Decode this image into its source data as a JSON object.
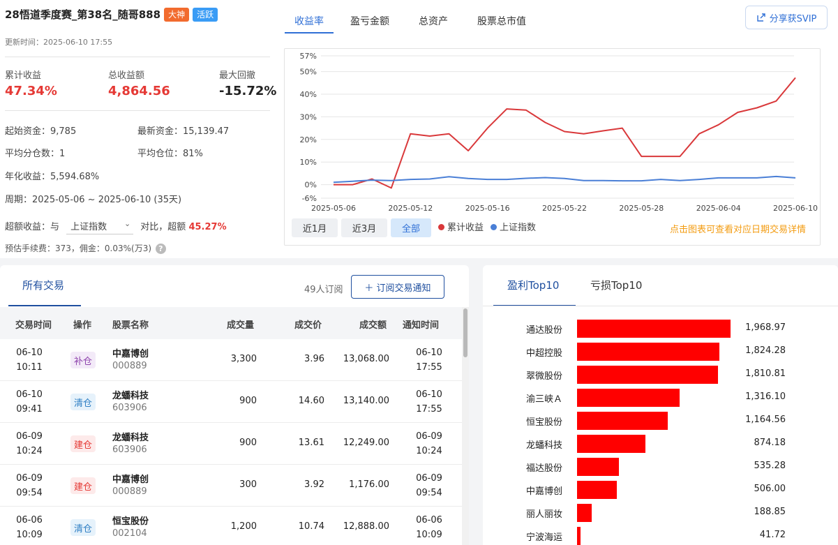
{
  "header": {
    "title": "28悟道季度赛_第38名_随哥888",
    "badges": [
      "大神",
      "活跃"
    ],
    "updated": "更新时间：2025-06-10 17:55",
    "share_label": "分享获SVIP"
  },
  "kpis": [
    {
      "label": "累计收益",
      "value": "47.34%",
      "color": "#e53935"
    },
    {
      "label": "总收益额",
      "value": "4,864.56",
      "color": "#e53935"
    },
    {
      "label": "最大回撤",
      "value": "-15.72%",
      "color": "#222222"
    }
  ],
  "stats": {
    "start_capital": "起始资金：9,785",
    "latest_capital": "最新资金：15,139.47",
    "avg_split": "平均分仓数：1",
    "avg_position": "平均仓位：81%",
    "annual": "年化收益：5,594.68%",
    "period": "周期：2025-05-06 ~ 2025-06-10 (35天)",
    "excess_prefix": "超额收益：与",
    "benchmark": "上证指数",
    "excess_mid": "对比，超额",
    "excess_value": "45.27%",
    "fees": "预估手续费：373，佣金：0.03%(万3)"
  },
  "chart_tabs": [
    "收益率",
    "盈亏金额",
    "总资产",
    "股票总市值"
  ],
  "range_buttons": [
    "近1月",
    "近3月",
    "全部"
  ],
  "legend": [
    "累计收益",
    "上证指数"
  ],
  "hint": "点击图表可查看对应日期交易详情",
  "chart_data": {
    "type": "line",
    "x": [
      "2025-05-06",
      "2025-05-07",
      "2025-05-08",
      "2025-05-09",
      "2025-05-12",
      "2025-05-13",
      "2025-05-14",
      "2025-05-15",
      "2025-05-16",
      "2025-05-19",
      "2025-05-20",
      "2025-05-21",
      "2025-05-22",
      "2025-05-23",
      "2025-05-26",
      "2025-05-27",
      "2025-05-28",
      "2025-05-29",
      "2025-05-30",
      "2025-06-03",
      "2025-06-04",
      "2025-06-05",
      "2025-06-06",
      "2025-06-09",
      "2025-06-10"
    ],
    "x_tick_labels": [
      "2025-05-06",
      "2025-05-12",
      "2025-05-16",
      "2025-05-22",
      "2025-05-28",
      "2025-06-04",
      "2025-06-10"
    ],
    "series": [
      {
        "name": "累计收益",
        "color": "#d9383a",
        "values": [
          0,
          0,
          2.5,
          -1.5,
          22.5,
          21.5,
          22.5,
          15,
          25,
          33.5,
          33,
          27.5,
          23.5,
          22.5,
          23.8,
          25,
          12.5,
          12.5,
          12.5,
          22.5,
          26.5,
          32,
          34,
          37,
          47.3
        ]
      },
      {
        "name": "上证指数",
        "color": "#4a7fd6",
        "values": [
          1,
          1.5,
          2,
          1.8,
          2.3,
          2.5,
          3.5,
          2.7,
          2.3,
          2.3,
          2.8,
          3.1,
          2.7,
          1.8,
          1.8,
          1.7,
          1.7,
          2.3,
          1.8,
          2.3,
          3,
          3,
          3,
          3.6,
          3
        ]
      }
    ],
    "y_ticks": [
      "57%",
      "50%",
      "40%",
      "30%",
      "20%",
      "10%",
      "0%",
      "-6%"
    ],
    "ylim": [
      -6,
      57
    ],
    "grid": "horizontal",
    "legend": "bottom-left"
  },
  "trades": {
    "tab_label": "所有交易",
    "subscribe_count": "49人订阅",
    "subscribe_label": "＋ 订阅交易通知",
    "columns": [
      "交易时间",
      "操作",
      "股票名称",
      "成交量",
      "成交价",
      "成交额",
      "通知时间"
    ],
    "rows": [
      {
        "date": "06-10",
        "time": "10:11",
        "op": "补仓",
        "op_style": "purple",
        "name": "中嘉博创",
        "code": "000889",
        "qty": "3,300",
        "price": "3.96",
        "amount": "13,068.00",
        "ndate": "06-10",
        "ntime": "17:55"
      },
      {
        "date": "06-10",
        "time": "09:41",
        "op": "清仓",
        "op_style": "blue",
        "name": "龙蟠科技",
        "code": "603906",
        "qty": "900",
        "price": "14.60",
        "amount": "13,140.00",
        "ndate": "06-10",
        "ntime": "17:55"
      },
      {
        "date": "06-09",
        "time": "10:24",
        "op": "建仓",
        "op_style": "red",
        "name": "龙蟠科技",
        "code": "603906",
        "qty": "900",
        "price": "13.61",
        "amount": "12,249.00",
        "ndate": "06-09",
        "ntime": "10:24"
      },
      {
        "date": "06-09",
        "time": "09:54",
        "op": "建仓",
        "op_style": "red",
        "name": "中嘉博创",
        "code": "000889",
        "qty": "300",
        "price": "3.92",
        "amount": "1,176.00",
        "ndate": "06-09",
        "ntime": "09:54"
      },
      {
        "date": "06-06",
        "time": "10:09",
        "op": "清仓",
        "op_style": "blue",
        "name": "恒宝股份",
        "code": "002104",
        "qty": "1,200",
        "price": "10.74",
        "amount": "12,888.00",
        "ndate": "06-06",
        "ntime": "10:09"
      }
    ]
  },
  "top10": {
    "tabs": [
      "盈利Top10",
      "亏损Top10"
    ],
    "bar_color": "#ff0000",
    "max_value": 1968.97,
    "items": [
      {
        "name": "通达股份",
        "value": 1968.97,
        "label": "1,968.97"
      },
      {
        "name": "中超控股",
        "value": 1824.28,
        "label": "1,824.28"
      },
      {
        "name": "翠微股份",
        "value": 1810.81,
        "label": "1,810.81"
      },
      {
        "name": "渝三峡Ａ",
        "value": 1316.1,
        "label": "1,316.10"
      },
      {
        "name": "恒宝股份",
        "value": 1164.56,
        "label": "1,164.56"
      },
      {
        "name": "龙蟠科技",
        "value": 874.18,
        "label": "874.18"
      },
      {
        "name": "福达股份",
        "value": 535.28,
        "label": "535.28"
      },
      {
        "name": "中嘉博创",
        "value": 506.0,
        "label": "506.00"
      },
      {
        "name": "丽人丽妆",
        "value": 188.85,
        "label": "188.85"
      },
      {
        "name": "宁波海运",
        "value": 41.72,
        "label": "41.72"
      }
    ]
  }
}
